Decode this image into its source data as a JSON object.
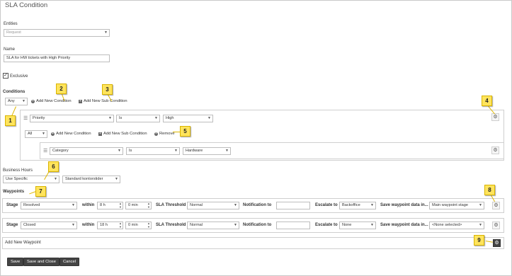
{
  "page": {
    "title": "SLA Condition"
  },
  "entities": {
    "label": "Entities",
    "value": "Request"
  },
  "name": {
    "label": "Name",
    "value": "SLA for HW tickets with High Priority"
  },
  "exclusive": {
    "label": "Exclusive",
    "checked": true
  },
  "conditions": {
    "label": "Conditions",
    "match": "Any",
    "add_condition": "Add New Condition",
    "add_sub_condition": "Add New Sub Condition",
    "row1": {
      "field": "Priority",
      "operator": "Is",
      "value": "High"
    },
    "sub": {
      "match": "All",
      "add_condition": "Add New Condition",
      "add_sub_condition": "Add New Sub Condition",
      "remove": "Remove",
      "row1": {
        "field": "Category",
        "operator": "Is",
        "value": "Hardware"
      }
    }
  },
  "business_hours": {
    "label": "Business Hours",
    "mode": "Use Specific",
    "schedule": "Standard kontorstider"
  },
  "waypoints": {
    "label": "Waypoints",
    "labels": {
      "stage": "Stage",
      "within": "within",
      "sla_threshold": "SLA Threshold",
      "notification_to": "Notification to",
      "escalate_to": "Escalate to",
      "save_data": "Save waypoint data in..."
    },
    "rows": [
      {
        "stage": "Resolved",
        "hours": "8 h",
        "minutes": "0 min",
        "threshold": "Normal",
        "notification": "",
        "escalate": "Backoffice",
        "save_in": "Main waypoint stage"
      },
      {
        "stage": "Closed",
        "hours": "18 h",
        "minutes": "0 min",
        "threshold": "Normal",
        "notification": "",
        "escalate": "None",
        "save_in": "<None selected>"
      }
    ],
    "add_new": "Add New Waypoint"
  },
  "buttons": {
    "save": "Save",
    "save_close": "Save and Close",
    "cancel": "Cancel"
  },
  "callouts": [
    "1",
    "2",
    "3",
    "4",
    "5",
    "6",
    "7",
    "8",
    "9"
  ]
}
